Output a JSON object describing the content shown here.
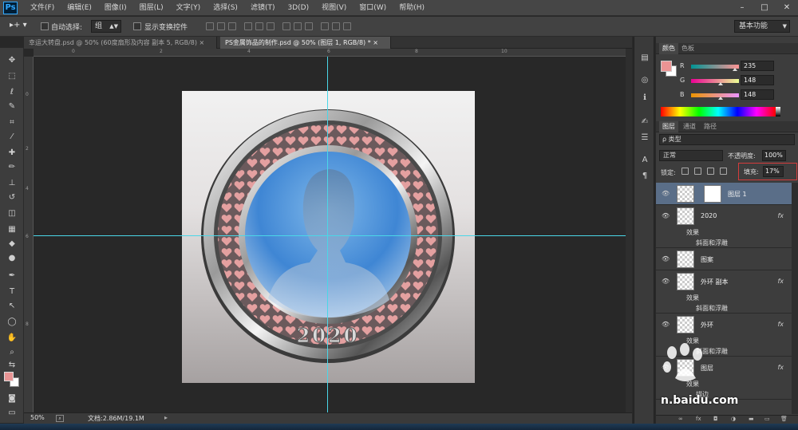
{
  "app": {
    "logo": "Ps"
  },
  "menu": [
    "文件(F)",
    "编辑(E)",
    "图像(I)",
    "图层(L)",
    "文字(Y)",
    "选择(S)",
    "滤镜(T)",
    "3D(D)",
    "视图(V)",
    "窗口(W)",
    "帮助(H)"
  ],
  "window_controls": {
    "minimize": "–",
    "maximize": "□",
    "close": "✕"
  },
  "options_bar": {
    "tool_icon": "▸+ ▾",
    "auto_select_label": "自动选择:",
    "auto_select_value": "组",
    "show_transform_label": "显示变换控件",
    "workspace": "基本功能"
  },
  "tabs": [
    {
      "label": "幸运大转盘.psd @ 50% (60度扇形及内容 副本 5, RGB/8)",
      "close": "×",
      "active": false
    },
    {
      "label": "PS金属饰品的制作.psd @ 50% (图层 1, RGB/8) *",
      "close": "×",
      "active": true
    }
  ],
  "ruler_top": [
    "0",
    "2",
    "4",
    "6",
    "8",
    "10"
  ],
  "ruler_left": [
    "0",
    "2",
    "4",
    "6",
    "8"
  ],
  "canvas": {
    "badge_text": "2020",
    "accent_guides": "#4ad7e8"
  },
  "status": {
    "zoom": "50%",
    "doc_info": "文档:2.86M/19.1M",
    "arrow": "▸"
  },
  "panels": {
    "color_tabs": [
      "颜色",
      "色板"
    ],
    "color": {
      "r_label": "R",
      "r": "235",
      "g_label": "G",
      "g": "148",
      "b_label": "B",
      "b": "148",
      "foreground": "#eb9494"
    },
    "layer_tabs": [
      "图层",
      "通道",
      "路径"
    ],
    "layer_filter": "ρ 类型",
    "blend_mode": "正常",
    "opacity_label": "不透明度:",
    "opacity_value": "100%",
    "lock_label": "锁定:",
    "fill_label": "填充:",
    "fill_value": "17%",
    "layers": [
      {
        "name": "图层 1",
        "selected": true,
        "fx": false,
        "has_mask": true
      },
      {
        "name": "2020",
        "selected": false,
        "fx": true,
        "effects": [
          "效果",
          "斜面和浮雕"
        ]
      },
      {
        "name": "图案",
        "selected": false,
        "fx": false
      },
      {
        "name": "外环 副本",
        "selected": false,
        "fx": true,
        "effects": [
          "效果",
          "斜面和浮雕"
        ]
      },
      {
        "name": "外环",
        "selected": false,
        "fx": true,
        "effects": [
          "效果",
          "斜面和浮雕"
        ]
      },
      {
        "name": "图层",
        "selected": false,
        "fx": true,
        "effects": [
          "效果",
          "描边"
        ]
      }
    ],
    "fx_label": "fx",
    "footer_icons": [
      "∞",
      "fx",
      "◘",
      "◑",
      "▬",
      "▭",
      "🗑"
    ]
  },
  "watermark": {
    "text": "n.baidu.com"
  }
}
